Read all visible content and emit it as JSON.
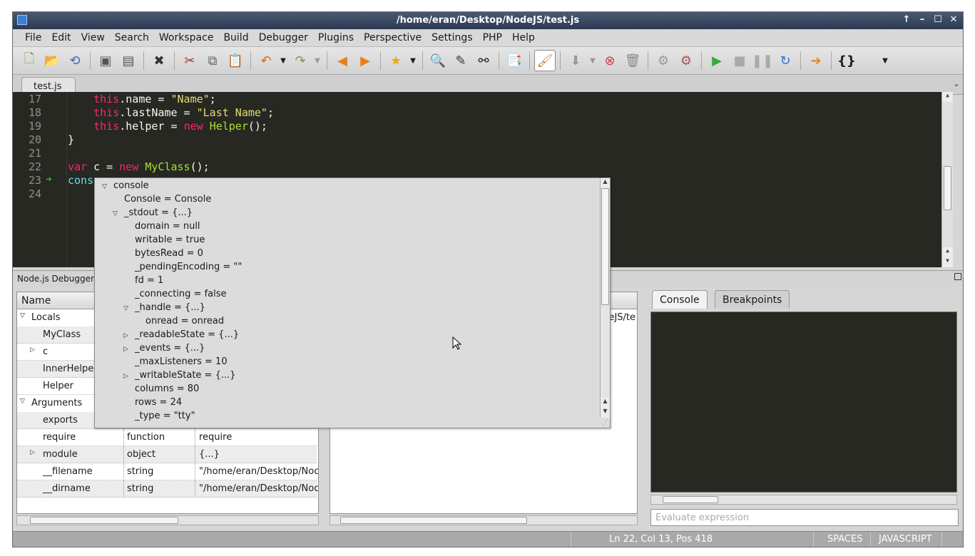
{
  "window": {
    "title": "/home/eran/Desktop/NodeJS/test.js",
    "controls": [
      "↑",
      "–",
      "☐",
      "✕"
    ]
  },
  "menu": [
    "File",
    "Edit",
    "View",
    "Search",
    "Workspace",
    "Build",
    "Debugger",
    "Plugins",
    "Perspective",
    "Settings",
    "PHP",
    "Help"
  ],
  "toolbar_icons": [
    "new-file-icon",
    "open-folder-icon",
    "reload-icon",
    "save-icon",
    "save-all-icon",
    "close-icon",
    "cut-icon",
    "copy-icon",
    "paste-icon",
    "undo-icon",
    "redo-icon",
    "back-arrow-icon",
    "forward-arrow-icon",
    "bookmark-star-icon",
    "search-icon",
    "replace-icon",
    "find-binoculars-icon",
    "paste-clipboard-icon",
    "brush-icon",
    "download-icon",
    "stop-red-icon",
    "trash-icon",
    "gear-icon",
    "gear-stop-icon",
    "run-icon",
    "stop-icon",
    "pause-icon",
    "refresh-icon",
    "step-over-icon",
    "braces-icon"
  ],
  "editor": {
    "tab": "test.js",
    "lines": [
      {
        "num": "17",
        "tokens": [
          {
            "t": "    ",
            "c": ""
          },
          {
            "t": "this",
            "c": "kw"
          },
          {
            "t": ".name = ",
            "c": ""
          },
          {
            "t": "\"Name\"",
            "c": "str"
          },
          {
            "t": ";",
            "c": ""
          }
        ]
      },
      {
        "num": "18",
        "tokens": [
          {
            "t": "    ",
            "c": ""
          },
          {
            "t": "this",
            "c": "kw"
          },
          {
            "t": ".lastName = ",
            "c": ""
          },
          {
            "t": "\"Last Name\"",
            "c": "str"
          },
          {
            "t": ";",
            "c": ""
          }
        ]
      },
      {
        "num": "19",
        "tokens": [
          {
            "t": "    ",
            "c": ""
          },
          {
            "t": "this",
            "c": "kw"
          },
          {
            "t": ".helper = ",
            "c": ""
          },
          {
            "t": "new",
            "c": "kw"
          },
          {
            "t": " ",
            "c": ""
          },
          {
            "t": "Helper",
            "c": "cls"
          },
          {
            "t": "();",
            "c": ""
          }
        ]
      },
      {
        "num": "20",
        "tokens": [
          {
            "t": "}",
            "c": ""
          }
        ]
      },
      {
        "num": "21",
        "tokens": []
      },
      {
        "num": "22",
        "tokens": [
          {
            "t": "var",
            "c": "kw"
          },
          {
            "t": " c = ",
            "c": ""
          },
          {
            "t": "new",
            "c": "kw"
          },
          {
            "t": " ",
            "c": ""
          },
          {
            "t": "MyClass",
            "c": "cls"
          },
          {
            "t": "();",
            "c": ""
          }
        ]
      },
      {
        "num": "23",
        "tokens": [
          {
            "t": "cons",
            "c": "var"
          }
        ]
      },
      {
        "num": "24",
        "tokens": []
      }
    ],
    "current_line_marker": "➜"
  },
  "debugger": {
    "panel_title": "Node.js Debugger",
    "name_header": "Name",
    "groups": {
      "locals": "Locals",
      "arguments": "Arguments"
    },
    "locals": [
      {
        "name": "MyClass",
        "type": "",
        "value": "",
        "expandable": false
      },
      {
        "name": "c",
        "type": "",
        "value": "",
        "expandable": true
      },
      {
        "name": "InnerHelper",
        "type": "",
        "value": "",
        "expandable": false
      },
      {
        "name": "Helper",
        "type": "",
        "value": "",
        "expandable": false
      }
    ],
    "arguments": [
      {
        "name": "exports",
        "type": "",
        "value": "",
        "expandable": false
      },
      {
        "name": "require",
        "type": "function",
        "value": "require",
        "expandable": false
      },
      {
        "name": "module",
        "type": "object",
        "value": "{...}",
        "expandable": true
      },
      {
        "name": "__filename",
        "type": "string",
        "value": "\"/home/eran/Desktop/Noc",
        "expandable": false
      },
      {
        "name": "__dirname",
        "type": "string",
        "value": "\"/home/eran/Desktop/Noc",
        "expandable": false
      }
    ],
    "callstack_fragment": "deJS/te",
    "right_tabs": [
      "Console",
      "Breakpoints"
    ],
    "eval_placeholder": "Evaluate expression"
  },
  "popup": {
    "rows": [
      {
        "indent": 0,
        "exp": "open",
        "text": "console"
      },
      {
        "indent": 1,
        "exp": "",
        "text": "Console = Console"
      },
      {
        "indent": 1,
        "exp": "open",
        "text": "_stdout = {...}"
      },
      {
        "indent": 2,
        "exp": "",
        "text": "domain = null"
      },
      {
        "indent": 2,
        "exp": "",
        "text": "writable = true"
      },
      {
        "indent": 2,
        "exp": "",
        "text": "bytesRead = 0"
      },
      {
        "indent": 2,
        "exp": "",
        "text": "_pendingEncoding = \"\""
      },
      {
        "indent": 2,
        "exp": "",
        "text": "fd = 1"
      },
      {
        "indent": 2,
        "exp": "",
        "text": "_connecting = false"
      },
      {
        "indent": 2,
        "exp": "open",
        "text": "_handle = {...}"
      },
      {
        "indent": 3,
        "exp": "",
        "text": "onread = onread"
      },
      {
        "indent": 2,
        "exp": "closed",
        "text": "_readableState = {...}"
      },
      {
        "indent": 2,
        "exp": "closed",
        "text": "_events = {...}"
      },
      {
        "indent": 2,
        "exp": "",
        "text": "_maxListeners = 10"
      },
      {
        "indent": 2,
        "exp": "closed",
        "text": "_writableState = {...}"
      },
      {
        "indent": 2,
        "exp": "",
        "text": "columns = 80"
      },
      {
        "indent": 2,
        "exp": "",
        "text": "rows = 24"
      },
      {
        "indent": 2,
        "exp": "",
        "text": "_type = \"tty\""
      }
    ]
  },
  "status": {
    "position": "Ln 22, Col 13, Pos 418",
    "indent": "SPACES",
    "language": "JAVASCRIPT"
  }
}
